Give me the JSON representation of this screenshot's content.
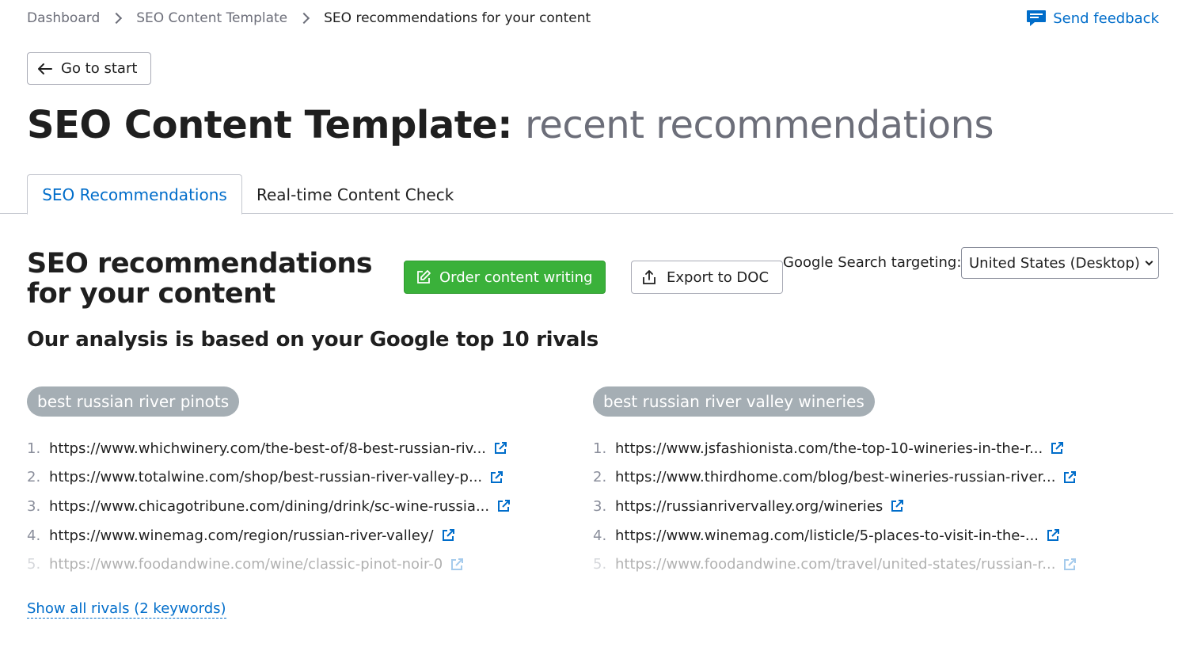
{
  "breadcrumb": {
    "items": [
      "Dashboard",
      "SEO Content Template"
    ],
    "current": "SEO recommendations for your content"
  },
  "feedback": {
    "label": "Send feedback",
    "icon": "comment-icon"
  },
  "go_to_start": {
    "label": "Go to start",
    "icon": "arrow-left-icon"
  },
  "page_title": {
    "main": "SEO Content Template:",
    "sub": "recent recommendations"
  },
  "tabs": [
    {
      "label": "SEO Recommendations",
      "active": true
    },
    {
      "label": "Real-time Content Check",
      "active": false
    }
  ],
  "section": {
    "title": "SEO recommendations for your content",
    "order_button": {
      "label": "Order content writing",
      "icon": "edit-icon"
    },
    "export_button": {
      "label": "Export to DOC",
      "icon": "export-icon"
    },
    "targeting": {
      "label": "Google Search targeting:",
      "value": "United States (Desktop)"
    },
    "analysis": "Our analysis is based on your Google top 10 rivals"
  },
  "keywords": [
    {
      "keyword": "best russian river pinots",
      "rivals": [
        "https://www.whichwinery.com/the-best-of/8-best-russian-riv...",
        "https://www.totalwine.com/shop/best-russian-river-valley-p...",
        "https://www.chicagotribune.com/dining/drink/sc-wine-russia...",
        "https://www.winemag.com/region/russian-river-valley/",
        "https://www.foodandwine.com/wine/classic-pinot-noir-0"
      ]
    },
    {
      "keyword": "best russian river valley wineries",
      "rivals": [
        "https://www.jsfashionista.com/the-top-10-wineries-in-the-r...",
        "https://www.thirdhome.com/blog/best-wineries-russian-river...",
        "https://russianrivervalley.org/wineries",
        "https://www.winemag.com/listicle/5-places-to-visit-in-the-...",
        "https://www.foodandwine.com/travel/united-states/russian-r..."
      ]
    }
  ],
  "rival_numbers": [
    "1.",
    "2.",
    "3.",
    "4.",
    "5."
  ],
  "show_all": "Show all rivals (2 keywords)",
  "colors": {
    "accent": "#006dca",
    "green": "#3ab13a",
    "pill": "#a5aeb4"
  }
}
